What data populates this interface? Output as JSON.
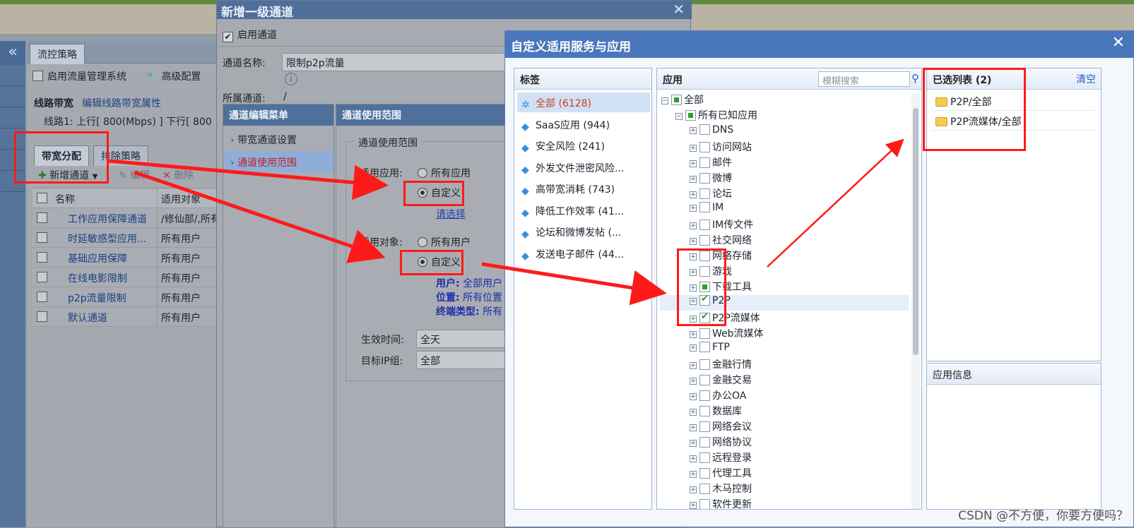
{
  "bg": {
    "tab_title": "流控策略",
    "enable_label": "启用流量管理系统",
    "advanced_label": "高级配置",
    "bandwidth_title": "线路带宽",
    "bandwidth_edit": "编辑线路带宽属性",
    "line1": "线路1:  上行[ 800(Mbps) ] 下行[ 800",
    "tabs": [
      "带宽分配",
      "排除策略"
    ],
    "toolbar": {
      "add": "新增通道",
      "edit": "编辑",
      "delete": "删除"
    },
    "grid": {
      "headers": [
        "名称",
        "适用对象"
      ],
      "rows": [
        {
          "name": "工作应用保障通道",
          "target": "/修仙部/,所有"
        },
        {
          "name": "时延敏感型应用...",
          "target": "所有用户"
        },
        {
          "name": "基础应用保障",
          "target": "所有用户"
        },
        {
          "name": "在线电影限制",
          "target": "所有用户"
        },
        {
          "name": "p2p流量限制",
          "target": "所有用户"
        },
        {
          "name": "默认通道",
          "target": "所有用户"
        }
      ]
    }
  },
  "dlg1": {
    "title": "新增一级通道",
    "enable_channel": "启用通道",
    "name_label": "通道名称:",
    "name_value": "限制p2p流量",
    "parent_label": "所属通道:",
    "parent_value": "/",
    "menu_head": "通道编辑菜单",
    "menu": [
      "带宽通道设置",
      "通道使用范围"
    ],
    "content_head": "通道使用范围",
    "legend": "通道使用范围",
    "app_label": "适用应用:",
    "app_all": "所有应用",
    "app_custom": "自定义",
    "choose_link": "请选择",
    "obj_label": "适用对象:",
    "obj_all": "所有用户",
    "obj_custom": "自定义",
    "user_key": "用户:",
    "user_val": "全部用户",
    "loc_key": "位置:",
    "loc_val": "所有位置",
    "term_key": "终端类型:",
    "term_val": "所有",
    "time_label": "生效时间:",
    "time_val": "全天",
    "ip_label": "目标IP组:",
    "ip_val": "全部"
  },
  "dlg2": {
    "title": "自定义适用服务与应用",
    "tags_head": "标签",
    "tags": [
      {
        "label": "全部 (6128)"
      },
      {
        "label": "SaaS应用 (944)"
      },
      {
        "label": "安全风险 (241)"
      },
      {
        "label": "外发文件泄密风险..."
      },
      {
        "label": "高带宽消耗 (743)"
      },
      {
        "label": "降低工作效率 (41..."
      },
      {
        "label": "论坛和微博发帖 (..."
      },
      {
        "label": "发送电子邮件 (44..."
      }
    ],
    "apps_head": "应用",
    "search_placeholder": "模糊搜索",
    "tree_root": "全部",
    "tree_known": "所有已知应用",
    "tree": [
      "DNS",
      "访问网站",
      "邮件",
      "微博",
      "论坛",
      "IM",
      "IM传文件",
      "社交网络",
      "网络存储",
      "游戏",
      "下载工具",
      "P2P",
      "P2P流媒体",
      "Web流媒体",
      "FTP",
      "金融行情",
      "金融交易",
      "办公OA",
      "数据库",
      "网络会议",
      "网络协议",
      "远程登录",
      "代理工具",
      "木马控制",
      "软件更新"
    ],
    "selected_head": "已选列表 (2)",
    "clear": "清空",
    "selected": [
      "P2P/全部",
      "P2P流媒体/全部"
    ],
    "info_head": "应用信息"
  },
  "watermark": "CSDN @不方便，你要方便吗？"
}
